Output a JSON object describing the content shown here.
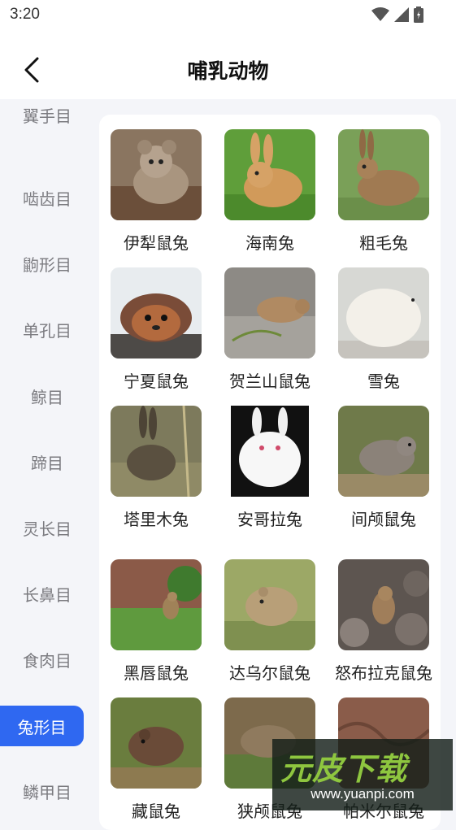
{
  "status": {
    "time": "3:20"
  },
  "header": {
    "title": "哺乳动物"
  },
  "sidebar": {
    "items": [
      {
        "label": "翼手目",
        "active": false
      },
      {
        "label": "啮齿目",
        "active": false
      },
      {
        "label": "鼩形目",
        "active": false
      },
      {
        "label": "单孔目",
        "active": false
      },
      {
        "label": "鲸目",
        "active": false
      },
      {
        "label": "蹄目",
        "active": false
      },
      {
        "label": "灵长目",
        "active": false
      },
      {
        "label": "长鼻目",
        "active": false
      },
      {
        "label": "食肉目",
        "active": false
      },
      {
        "label": "兔形目",
        "active": true
      },
      {
        "label": "鳞甲目",
        "active": false
      }
    ]
  },
  "animals": [
    {
      "name": "伊犁鼠兔"
    },
    {
      "name": "海南兔"
    },
    {
      "name": "粗毛兔"
    },
    {
      "name": "宁夏鼠兔"
    },
    {
      "name": "贺兰山鼠兔"
    },
    {
      "name": "雪兔"
    },
    {
      "name": "塔里木兔"
    },
    {
      "name": "安哥拉兔"
    },
    {
      "name": "间颅鼠兔"
    },
    {
      "name": "黑唇鼠兔"
    },
    {
      "name": "达乌尔鼠兔"
    },
    {
      "name": "怒布拉克鼠兔"
    },
    {
      "name": "藏鼠兔"
    },
    {
      "name": "狭颅鼠兔"
    },
    {
      "name": "帕米尔鼠兔"
    }
  ],
  "watermark": {
    "main": "元皮下载",
    "sub": "www.yuanpi.com"
  }
}
